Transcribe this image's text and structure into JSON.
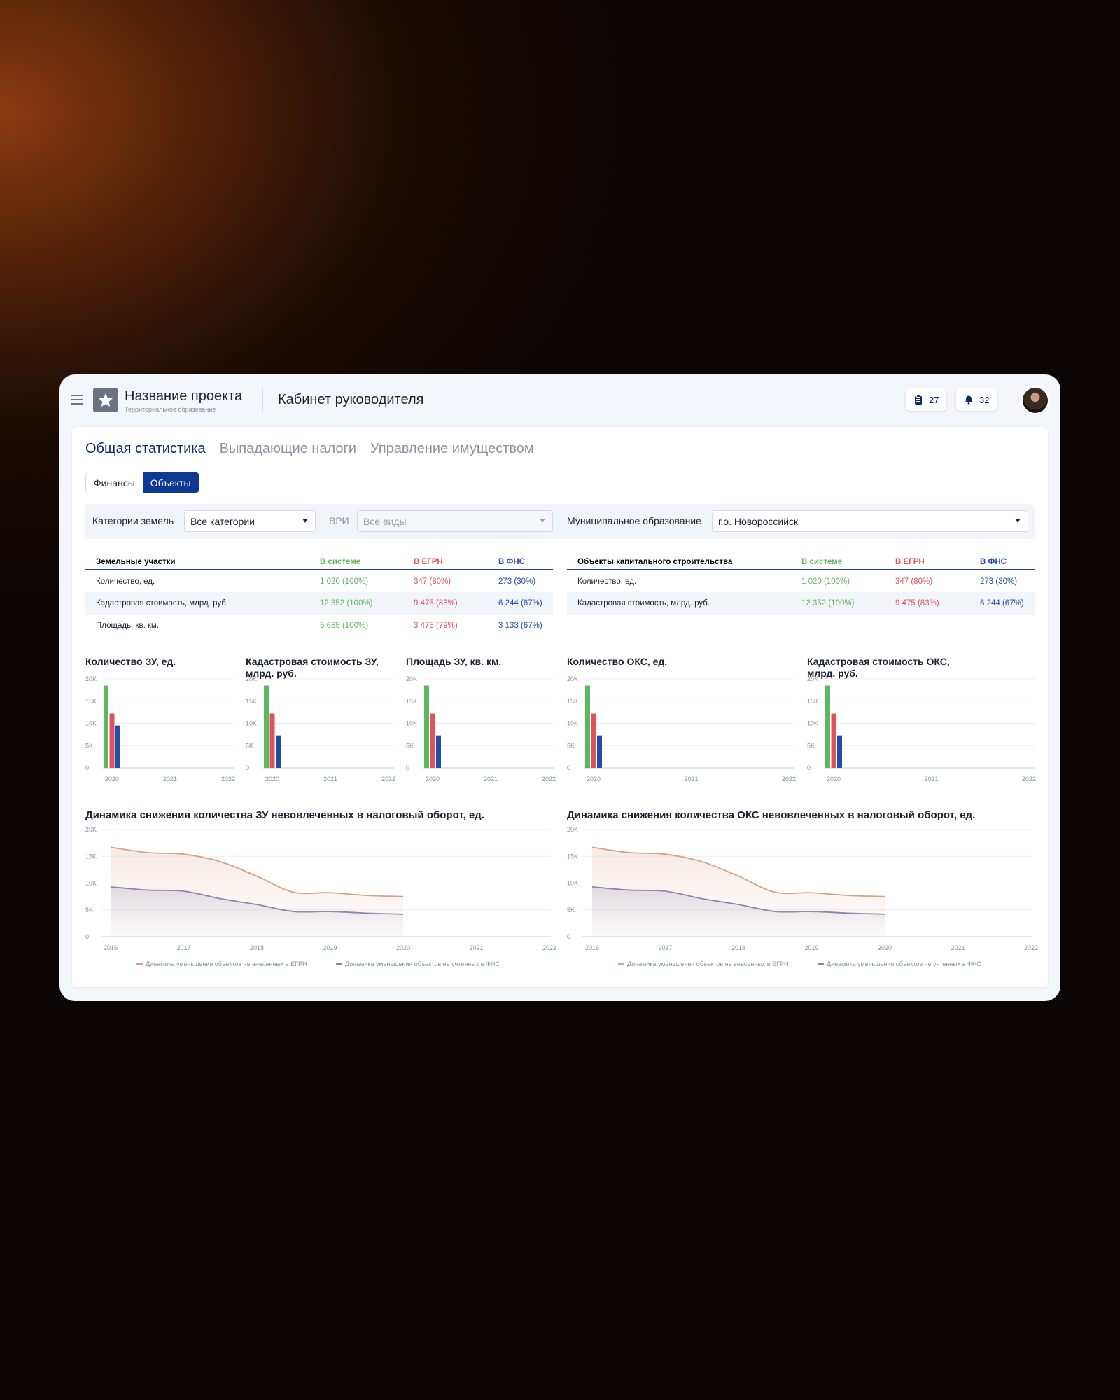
{
  "header": {
    "project_title": "Название проекта",
    "project_subtitle": "Территориальное образование",
    "cabinet_title": "Кабинет руководителя",
    "tasks_count": "27",
    "notifications_count": "32"
  },
  "tabs": [
    "Общая статистика",
    "Выпадающие налоги",
    "Управление имуществом"
  ],
  "segments": [
    "Финансы",
    "Объекты"
  ],
  "filters": {
    "land_category_label": "Категории земель",
    "land_category_value": "Все категории",
    "vri_label": "ВРИ",
    "vri_value": "Все виды",
    "municipality_label": "Муниципальное образование",
    "municipality_value": "г.о. Новороссийск"
  },
  "land_table": {
    "headers": [
      "Земельные участки",
      "В системе",
      "В ЕГРН",
      "В ФНС"
    ],
    "rows": [
      [
        "Количество, ед.",
        "1 020 (100%)",
        "347 (80%)",
        "273 (30%)"
      ],
      [
        "Кадастровая стоимость, млрд. руб.",
        "12 352 (100%)",
        "9 475 (83%)",
        "6 244 (67%)"
      ],
      [
        "Площадь, кв. км.",
        "5 685 (100%)",
        "3 475 (79%)",
        "3 133 (67%)"
      ]
    ]
  },
  "oks_table": {
    "headers": [
      "Объекты капитального строительства",
      "В системе",
      "В ЕГРН",
      "В ФНС"
    ],
    "rows": [
      [
        "Количество, ед.",
        "1 020 (100%)",
        "347 (80%)",
        "273 (30%)"
      ],
      [
        "Кадастровая стоимость, млрд. руб.",
        "12 352 (100%)",
        "9 475 (83%)",
        "6 244 (67%)"
      ]
    ]
  },
  "colors": {
    "accent": "#0f2a6e",
    "green": "#5cb85c",
    "red": "#e0525b",
    "blue": "#1f4ea8",
    "egrn_line": "#d9a184",
    "fns_line": "#8a86ad"
  },
  "chart_data": [
    {
      "type": "bar",
      "title": "Количество ЗУ, ед.",
      "categories": [
        "2020",
        "2021",
        "2022"
      ],
      "yticks": [
        "0",
        "5K",
        "10K",
        "15K",
        "20K"
      ],
      "ylim": [
        0,
        20000
      ],
      "series": [
        {
          "values": [
            18500,
            null,
            null
          ]
        },
        {
          "values": [
            12200,
            null,
            null
          ]
        },
        {
          "values": [
            9500,
            null,
            null
          ]
        }
      ]
    },
    {
      "type": "bar",
      "title": "Кадастровая стоимость ЗУ, млрд. руб.",
      "categories": [
        "2020",
        "2021",
        "2022"
      ],
      "yticks": [
        "0",
        "5K",
        "10K",
        "15K",
        "20K"
      ],
      "ylim": [
        0,
        20000
      ],
      "series": [
        {
          "values": [
            18500,
            null,
            null
          ]
        },
        {
          "values": [
            12200,
            null,
            null
          ]
        },
        {
          "values": [
            7300,
            null,
            null
          ]
        }
      ]
    },
    {
      "type": "bar",
      "title": "Площадь ЗУ, кв. км.",
      "categories": [
        "2020",
        "2021",
        "2022"
      ],
      "yticks": [
        "0",
        "5K",
        "10K",
        "15K",
        "20K"
      ],
      "ylim": [
        0,
        20000
      ],
      "series": [
        {
          "values": [
            18500,
            null,
            null
          ]
        },
        {
          "values": [
            12200,
            null,
            null
          ]
        },
        {
          "values": [
            7300,
            null,
            null
          ]
        }
      ]
    },
    {
      "type": "bar",
      "title": "Количество ОКС, ед.",
      "categories": [
        "2020",
        "2021",
        "2022"
      ],
      "yticks": [
        "0",
        "5K",
        "10K",
        "15K",
        "20K"
      ],
      "ylim": [
        0,
        20000
      ],
      "series": [
        {
          "values": [
            18500,
            null,
            null
          ]
        },
        {
          "values": [
            12200,
            null,
            null
          ]
        },
        {
          "values": [
            7300,
            null,
            null
          ]
        }
      ]
    },
    {
      "type": "bar",
      "title": "Кадастровая стоимость ОКС, млрд. руб.",
      "categories": [
        "2020",
        "2021",
        "2022"
      ],
      "yticks": [
        "0",
        "5K",
        "10K",
        "15K",
        "20K"
      ],
      "ylim": [
        0,
        20000
      ],
      "series": [
        {
          "values": [
            18500,
            null,
            null
          ]
        },
        {
          "values": [
            12200,
            null,
            null
          ]
        },
        {
          "values": [
            7300,
            null,
            null
          ]
        }
      ]
    },
    {
      "type": "area",
      "title": "Динамика снижения количества ЗУ невовлеченных в налоговый оборот, ед.",
      "xticks": [
        "2016",
        "2017",
        "2018",
        "2019",
        "2020",
        "2021",
        "2022"
      ],
      "yticks": [
        "0",
        "5K",
        "10K",
        "15K",
        "20K"
      ],
      "ylim": [
        0,
        20000
      ],
      "x": [
        2016,
        2016.5,
        2017,
        2017.5,
        2018,
        2018.5,
        2019,
        2019.5,
        2020
      ],
      "series": [
        {
          "name": "Динамика уменьшения объектов не внесенных в ЕГРН",
          "values": [
            16700,
            15700,
            15400,
            14000,
            11300,
            8300,
            8200,
            7700,
            7500
          ]
        },
        {
          "name": "Динамика уменьшения объектов не учтенных в ФНС",
          "values": [
            9300,
            8700,
            8500,
            7100,
            6000,
            4700,
            4700,
            4400,
            4200
          ]
        }
      ]
    },
    {
      "type": "area",
      "title": "Динамика снижения количества ОКС невовлеченных в налоговый оборот, ед.",
      "xticks": [
        "2016",
        "2017",
        "2018",
        "2019",
        "2020",
        "2021",
        "2022"
      ],
      "yticks": [
        "0",
        "5K",
        "10K",
        "15K",
        "20K"
      ],
      "ylim": [
        0,
        20000
      ],
      "x": [
        2016,
        2016.5,
        2017,
        2017.5,
        2018,
        2018.5,
        2019,
        2019.5,
        2020
      ],
      "series": [
        {
          "name": "Динамика уменьшения объектов не внесенных в ЕГРН",
          "values": [
            16700,
            15700,
            15400,
            14000,
            11300,
            8300,
            8200,
            7700,
            7500
          ]
        },
        {
          "name": "Динамика уменьшения объектов не учтенных в ФНС",
          "values": [
            9300,
            8700,
            8500,
            7100,
            6000,
            4700,
            4700,
            4400,
            4200
          ]
        }
      ]
    }
  ]
}
